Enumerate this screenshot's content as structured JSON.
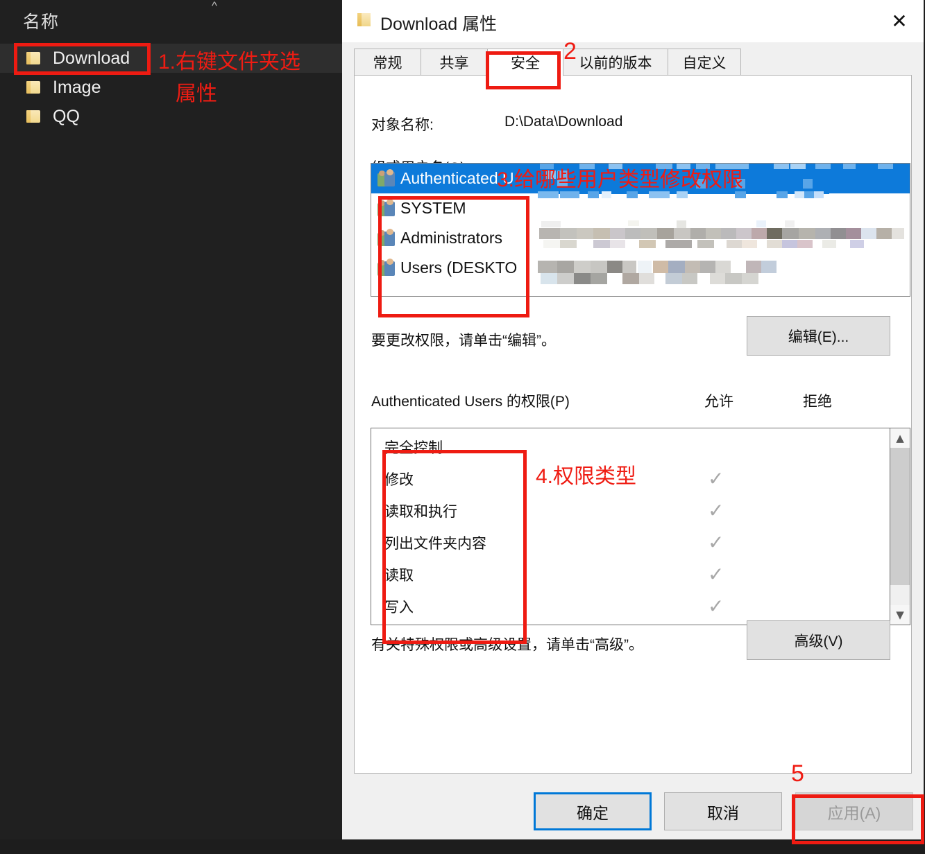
{
  "explorer": {
    "column_header": "名称",
    "sort_chevron_icon": "chevron-up-icon",
    "folders": [
      {
        "label": "Download",
        "icon": "folder-icon",
        "selected": true
      },
      {
        "label": "Image",
        "icon": "folder-icon",
        "selected": false
      },
      {
        "label": "QQ",
        "icon": "folder-icon",
        "selected": false
      }
    ]
  },
  "dialog": {
    "title": "Download 属性",
    "title_icon": "folder-icon",
    "close_icon": "close-icon",
    "tabs": [
      {
        "label": "常规",
        "active": false
      },
      {
        "label": "共享",
        "active": false
      },
      {
        "label": "安全",
        "active": true
      },
      {
        "label": "以前的版本",
        "active": false
      },
      {
        "label": "自定义",
        "active": false
      }
    ],
    "object_name_label": "对象名称:",
    "object_name_value": "D:\\Data\\Download",
    "group_users_label": "组或用户名(G):",
    "users": [
      {
        "name": "Authenticated U",
        "selected": true
      },
      {
        "name": "SYSTEM",
        "selected": false
      },
      {
        "name": "Administrators",
        "selected": false
      },
      {
        "name": "Users (DESKTO",
        "selected": false
      }
    ],
    "edit_hint": "要更改权限，请单击“编辑”。",
    "edit_button": "编辑(E)...",
    "permissions_header": "Authenticated Users 的权限(P)",
    "allow_header": "允许",
    "deny_header": "拒绝",
    "permissions": [
      {
        "label": "完全控制",
        "allow": false,
        "deny": false
      },
      {
        "label": "修改",
        "allow": true,
        "deny": false
      },
      {
        "label": "读取和执行",
        "allow": true,
        "deny": false
      },
      {
        "label": "列出文件夹内容",
        "allow": true,
        "deny": false
      },
      {
        "label": "读取",
        "allow": true,
        "deny": false
      },
      {
        "label": "写入",
        "allow": true,
        "deny": false
      }
    ],
    "scrollbar": {
      "up_icon": "chevron-up-icon",
      "down_icon": "chevron-down-icon"
    },
    "advanced_hint": "有关特殊权限或高级设置，请单击“高级”。",
    "advanced_button": "高级(V)",
    "footer": {
      "ok": "确定",
      "cancel": "取消",
      "apply": "应用(A)"
    }
  },
  "annotations": {
    "step1": "1.右键文件夹选",
    "step1b": "属性",
    "step2": "2",
    "step3": "3.给哪些用户类型修改权限",
    "step4": "4.权限类型",
    "step5": "5",
    "color": "#ef1c13"
  }
}
